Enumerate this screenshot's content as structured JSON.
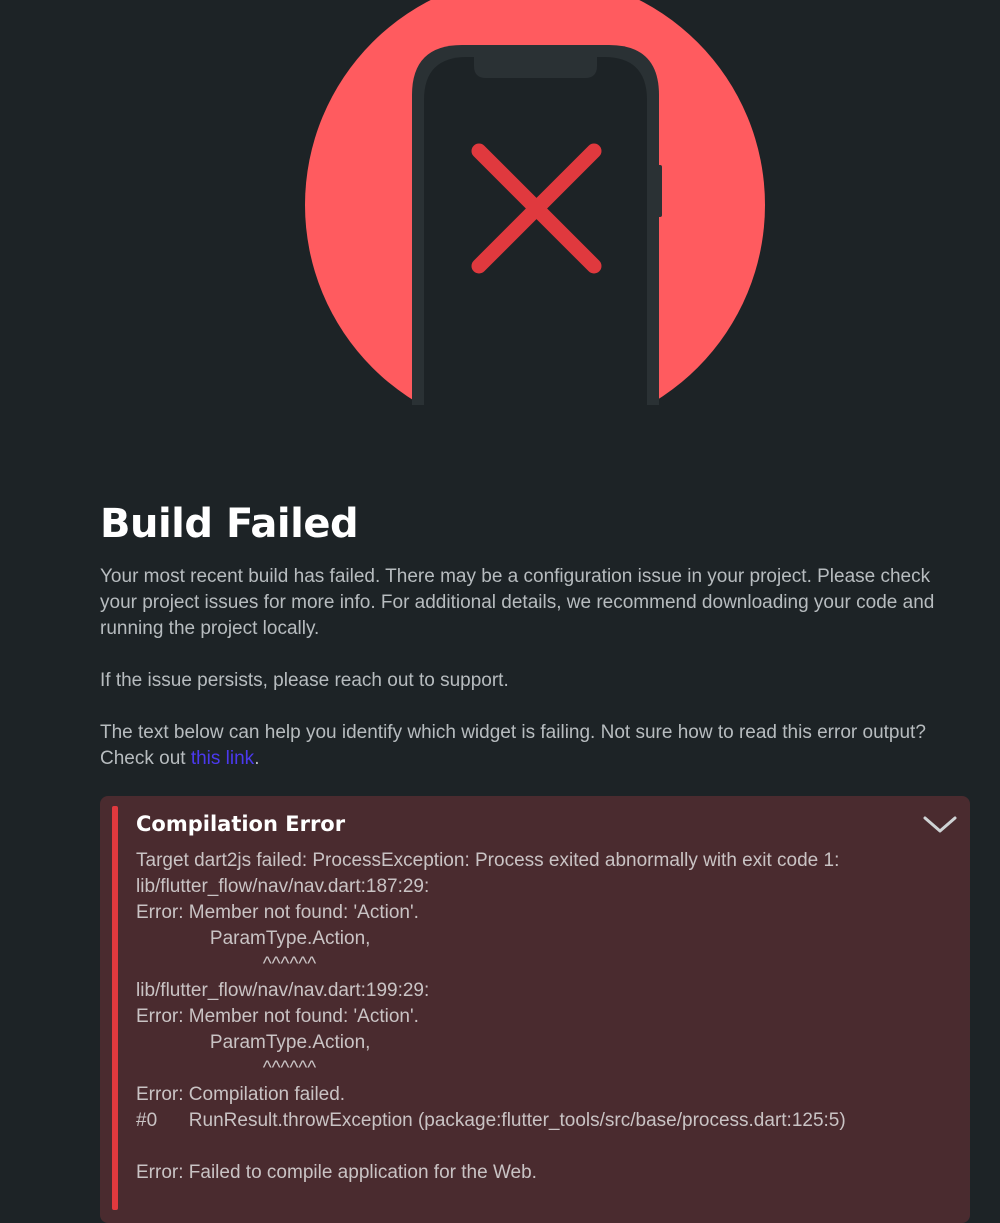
{
  "colors": {
    "background": "#1d2326",
    "accent_circle": "#ff5b5f",
    "x_mark": "#e0393e",
    "phone": "#1d2326",
    "link": "#4b39ef",
    "error_panel": "#4a2b2f",
    "error_bar": "#e0393e"
  },
  "illustration": {
    "icon": "phone-error-illustration",
    "mark_icon": "close-icon"
  },
  "header": {
    "title": "Build Failed"
  },
  "body": {
    "paragraph1": "Your most recent build has failed. There may be a configuration issue in your project. Please check your project issues for more info. For additional details, we recommend downloading your code and running the project locally.",
    "paragraph2": "If the issue persists, please reach out to support.",
    "paragraph3_text": "The text below can help you identify which widget is failing. Not sure how to read this error output? Check out ",
    "paragraph3_link": "this link",
    "paragraph3_end": "."
  },
  "error": {
    "title": "Compilation Error",
    "toggle_icon": "chevron-down-icon",
    "output": "Target dart2js failed: ProcessException: Process exited abnormally with exit code 1:\nlib/flutter_flow/nav/nav.dart:187:29:\nError: Member not found: 'Action'.\n              ParamType.Action,\n                        ^^^^^^\nlib/flutter_flow/nav/nav.dart:199:29:\nError: Member not found: 'Action'.\n              ParamType.Action,\n                        ^^^^^^\nError: Compilation failed.\n#0      RunResult.throwException (package:flutter_tools/src/base/process.dart:125:5)\n\nError: Failed to compile application for the Web."
  }
}
